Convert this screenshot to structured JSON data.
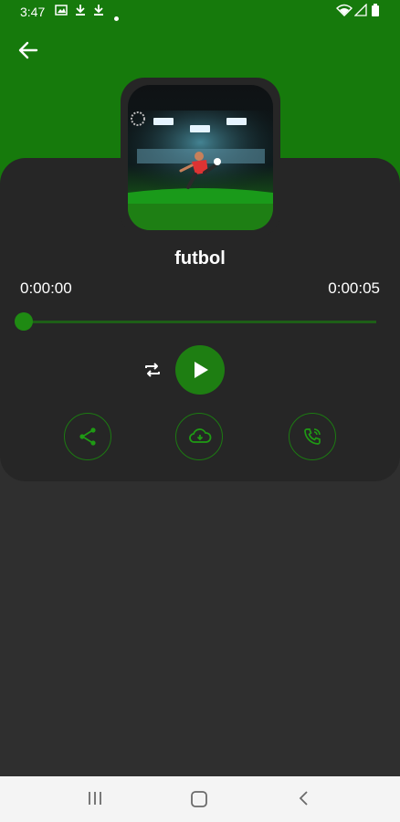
{
  "status_bar": {
    "time": "3:47",
    "icons": [
      "gallery-icon",
      "download-icon",
      "download-icon",
      "dot-icon",
      "wifi-icon",
      "signal-icon",
      "battery-icon"
    ]
  },
  "header": {
    "back_icon": "arrow-left-icon"
  },
  "player": {
    "title": "futbol",
    "current_time": "0:00:00",
    "total_time": "0:00:05",
    "progress": 0.0
  },
  "actions": [
    "share-icon",
    "cloud-download-icon",
    "phone-ringtone-icon"
  ],
  "colors": {
    "primary_green": "#167a0c",
    "button_green": "#1e7e12",
    "card_bg": "#262626",
    "page_bg": "#2f2f2f"
  },
  "nav_bar": [
    "recent-apps-icon",
    "home-icon",
    "back-icon"
  ]
}
